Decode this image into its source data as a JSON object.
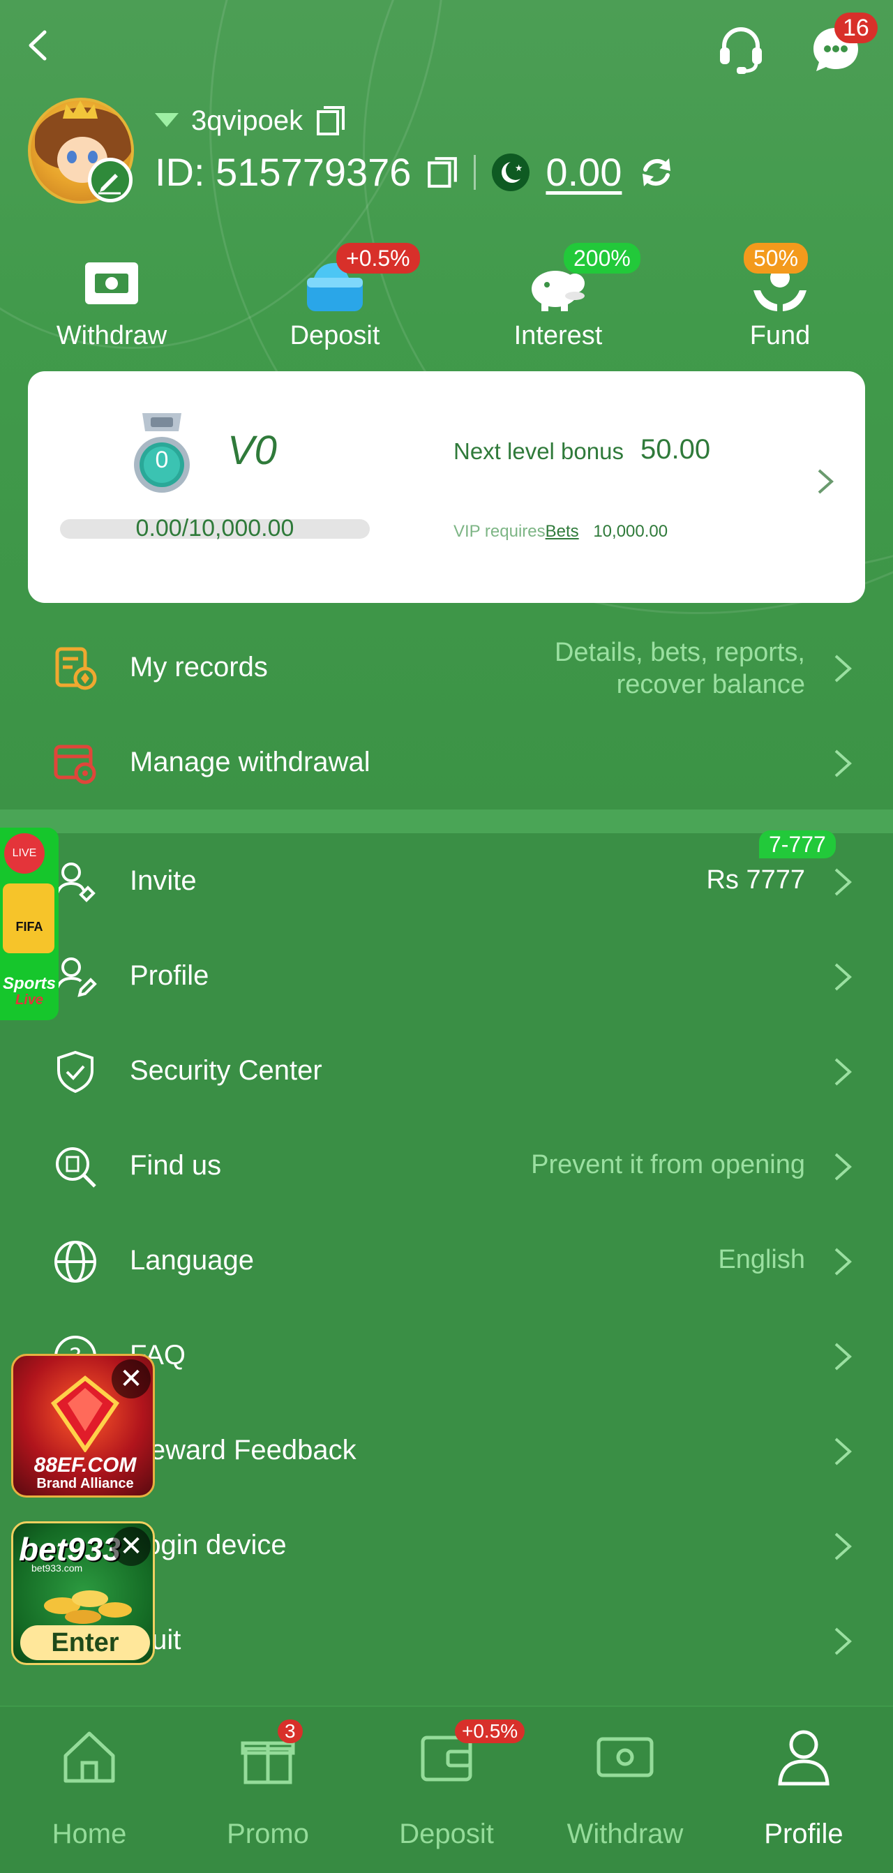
{
  "header": {
    "notification_count": "16"
  },
  "user": {
    "username": "3qvipoek",
    "id_label": "ID: 515779376",
    "balance": "0.00"
  },
  "quick_actions": [
    {
      "label": "Withdraw",
      "badge": ""
    },
    {
      "label": "Deposit",
      "badge": "+0.5%"
    },
    {
      "label": "Interest",
      "badge": "200%"
    },
    {
      "label": "Fund",
      "badge": "50%"
    }
  ],
  "vip": {
    "medal_level": "0",
    "level_name": "V0",
    "progress_text": "0.00/10,000.00",
    "progress_fraction": 0,
    "next_bonus_label": "Next level bonus",
    "next_bonus_value": "50.00",
    "requires_label": "VIP requires",
    "requires_link": "Bets",
    "requires_value": "10,000.00"
  },
  "menu_top": [
    {
      "label": "My records",
      "right_line1": "Details, bets, reports,",
      "right_line2": "recover balance"
    },
    {
      "label": "Manage withdrawal",
      "right": ""
    }
  ],
  "menu_main": [
    {
      "label": "Invite",
      "right": "Rs 7777",
      "badge": "7-777"
    },
    {
      "label": "Profile",
      "right": ""
    },
    {
      "label": "Security Center",
      "right": ""
    },
    {
      "label": "Find us",
      "right": "Prevent it from opening"
    },
    {
      "label": "Language",
      "right": "English"
    },
    {
      "label": "FAQ",
      "right": ""
    },
    {
      "label": "Reward Feedback",
      "right": ""
    },
    {
      "label": "Login device",
      "right": ""
    },
    {
      "label": "Quit",
      "right": ""
    }
  ],
  "floating": {
    "live_badge": "LIVE",
    "live_title": "FIFA",
    "live_label": "Sports",
    "live_sublabel": "Live",
    "ad1_brand": "88EF.COM",
    "ad1_sub": "Brand Alliance",
    "ad2_brand": "bet933",
    "ad2_small": "bet933.com",
    "ad2_button": "Enter"
  },
  "bottom_nav": [
    {
      "label": "Home",
      "badge": ""
    },
    {
      "label": "Promo",
      "badge": "3"
    },
    {
      "label": "Deposit",
      "badge": "+0.5%"
    },
    {
      "label": "Withdraw",
      "badge": ""
    },
    {
      "label": "Profile",
      "badge": ""
    }
  ],
  "colors": {
    "background": "#3a8f45",
    "accent_green": "#2f7a3a",
    "badge_red": "#d8302a",
    "badge_green": "#22c93a",
    "badge_orange": "#f39a1c",
    "muted_text": "#9be0a1"
  }
}
